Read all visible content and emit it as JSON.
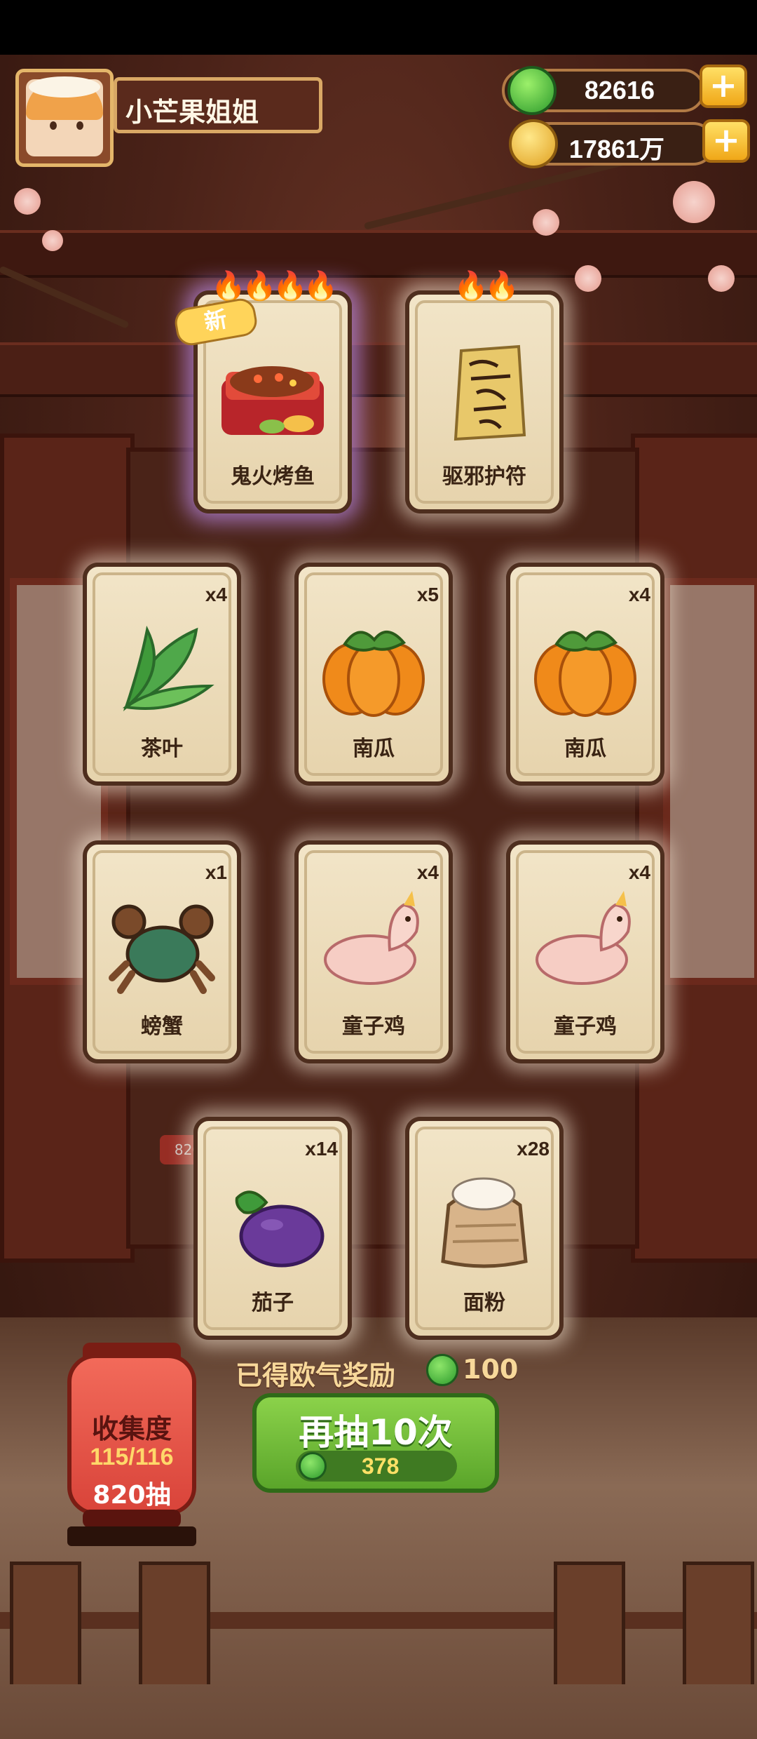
{
  "player": {
    "name": "小芒果姐姐"
  },
  "currency": {
    "jade": {
      "value": "82616",
      "icon": "jade-coin-icon",
      "color": "#2c9a2c"
    },
    "gold": {
      "value": "17861万",
      "icon": "gold-coin-icon",
      "color": "#f0b020"
    }
  },
  "cards": [
    {
      "name": "鬼火烤鱼",
      "count": "",
      "stars": 4,
      "new_label": "新",
      "art": "grilled-fish-icon"
    },
    {
      "name": "驱邪护符",
      "count": "",
      "stars": 2,
      "art": "talisman-icon"
    },
    {
      "name": "茶叶",
      "count": "x4",
      "art": "tea-leaf-icon"
    },
    {
      "name": "南瓜",
      "count": "x5",
      "art": "pumpkin-icon"
    },
    {
      "name": "南瓜",
      "count": "x4",
      "art": "pumpkin-icon"
    },
    {
      "name": "螃蟹",
      "count": "x1",
      "art": "crab-icon"
    },
    {
      "name": "童子鸡",
      "count": "x4",
      "art": "chicken-icon"
    },
    {
      "name": "童子鸡",
      "count": "x4",
      "art": "chicken-icon"
    },
    {
      "name": "茄子",
      "count": "x14",
      "art": "eggplant-icon"
    },
    {
      "name": "面粉",
      "count": "x28",
      "art": "flour-sack-icon"
    }
  ],
  "background_badge": "820抽",
  "reward": {
    "label": "已得欧气奖励",
    "value": "100"
  },
  "collection": {
    "title": "收集度",
    "progress": "115/116",
    "draws": "820抽"
  },
  "draw_again": {
    "label": "再抽10次",
    "cost": "378"
  }
}
